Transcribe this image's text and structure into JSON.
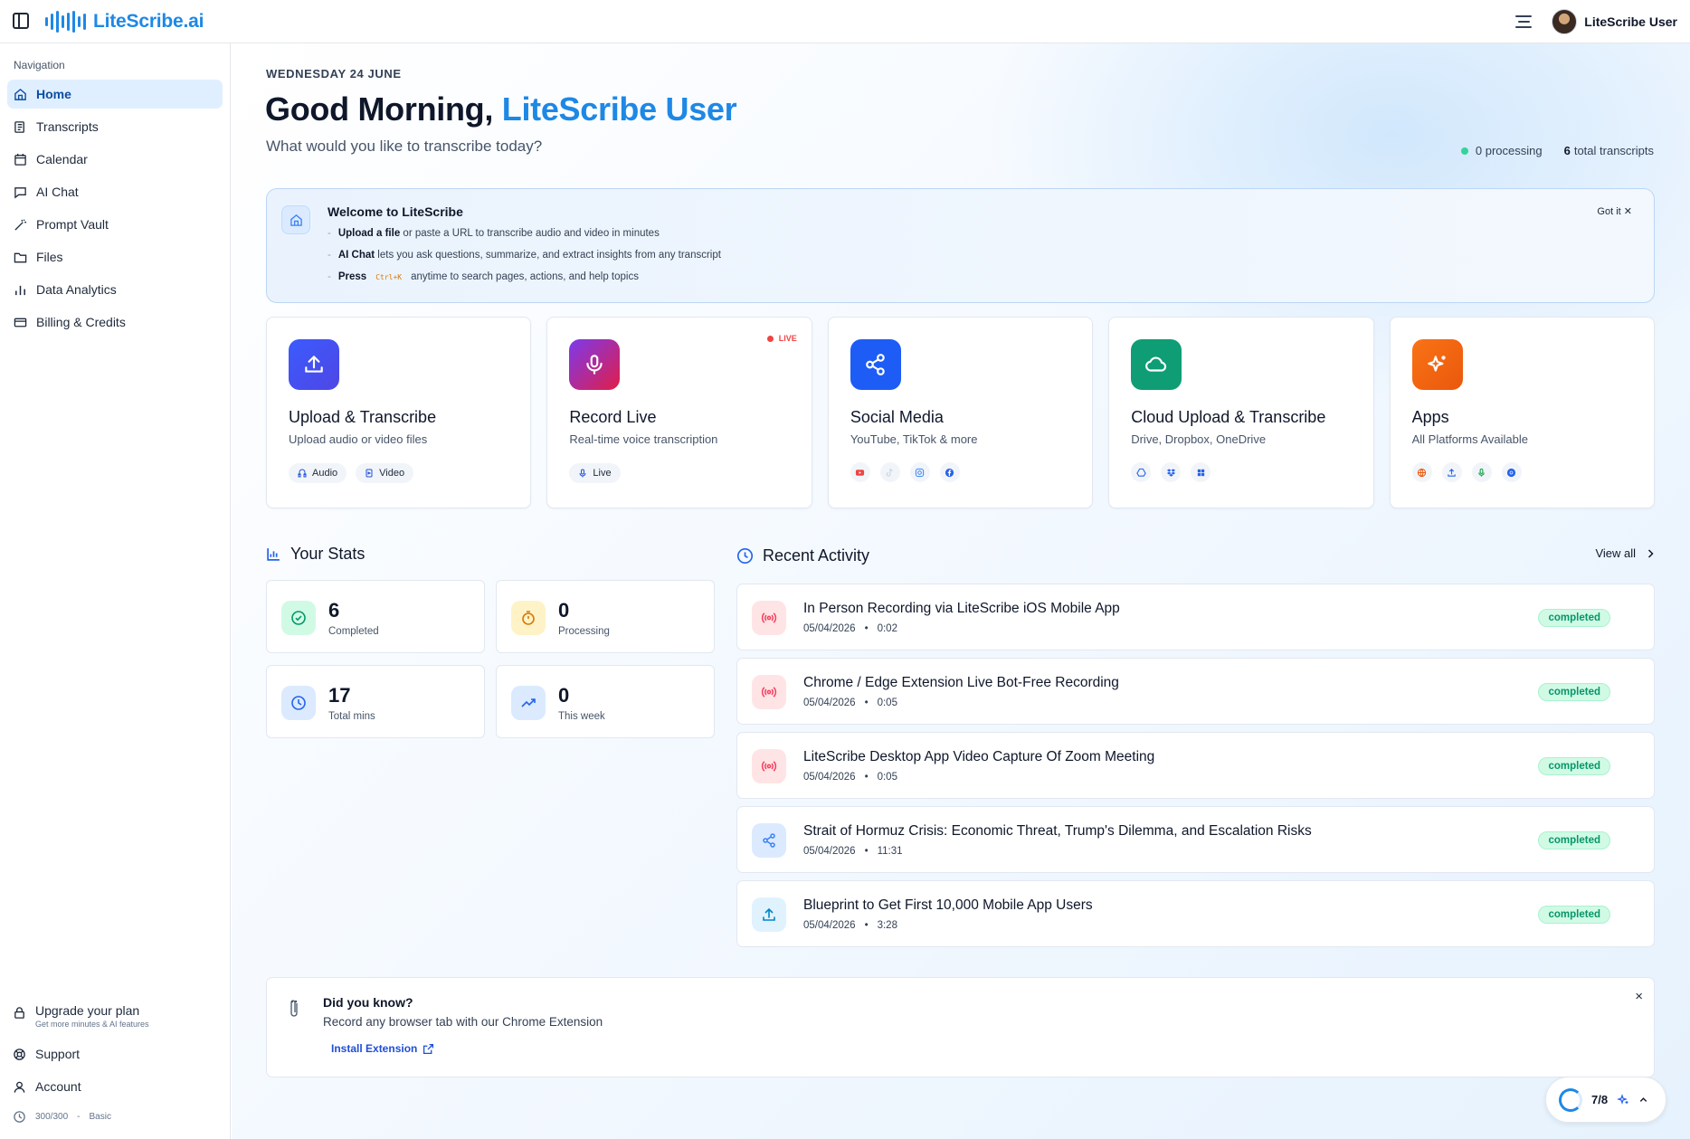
{
  "app": {
    "logo_text": "LiteScribe.ai",
    "user_name": "LiteScribe User"
  },
  "colors": {
    "brand": "#1e88e5",
    "upload": "#4f46e5",
    "record": "#e11d48",
    "social": "#1d4ed8",
    "cloud": "#0f9d75",
    "apps": "#ea580c",
    "completed": "#059669"
  },
  "sidebar": {
    "heading": "Navigation",
    "items": [
      {
        "label": "Home",
        "icon": "home-icon",
        "active": true
      },
      {
        "label": "Transcripts",
        "icon": "transcripts-icon"
      },
      {
        "label": "Calendar",
        "icon": "calendar-icon"
      },
      {
        "label": "AI Chat",
        "icon": "chat-icon"
      },
      {
        "label": "Prompt Vault",
        "icon": "wand-icon"
      },
      {
        "label": "Files",
        "icon": "folder-icon"
      },
      {
        "label": "Data Analytics",
        "icon": "bar-chart-icon"
      },
      {
        "label": "Billing & Credits",
        "icon": "credit-card-icon"
      }
    ],
    "upgrade": {
      "title": "Upgrade your plan",
      "sub": "Get more minutes & AI features"
    },
    "support": "Support",
    "account": "Account",
    "credits": "300/300",
    "credits_sep": "-",
    "plan": "Basic"
  },
  "header": {
    "date": "WEDNESDAY 24 JUNE",
    "greeting": "Good Morning,",
    "name": "LiteScribe User",
    "subtitle": "What would you like to transcribe today?",
    "processing": "0 processing",
    "total_count": "6",
    "total_label": "total transcripts"
  },
  "welcome": {
    "title": "Welcome to LiteScribe",
    "l1_bold": "Upload a file",
    "l1_rest": "or paste a URL to transcribe audio and video in minutes",
    "l2_bold": "AI Chat",
    "l2_rest": "lets you ask questions, summarize, and extract insights from any transcript",
    "l3_bold": "Press",
    "l3_key": "Ctrl+K",
    "l3_rest": "anytime to search pages, actions, and help topics",
    "dismiss": "Got it"
  },
  "actions": {
    "upload": {
      "title": "Upload & Transcribe",
      "sub": "Upload audio or video files",
      "chip1": "Audio",
      "chip2": "Video"
    },
    "record": {
      "title": "Record Live",
      "sub": "Real-time voice transcription",
      "badge": "LIVE",
      "chip1": "Live"
    },
    "social": {
      "title": "Social Media",
      "sub": "YouTube, TikTok & more",
      "platforms": [
        "youtube-icon",
        "tiktok-icon",
        "instagram-icon",
        "facebook-icon"
      ]
    },
    "cloud": {
      "title": "Cloud Upload & Transcribe",
      "sub": "Drive, Dropbox, OneDrive",
      "platforms": [
        "google-drive-icon",
        "dropbox-icon",
        "onedrive-icon"
      ]
    },
    "apps": {
      "title": "Apps",
      "sub": "All Platforms Available",
      "platforms": [
        "web-icon",
        "upload-icon",
        "mic-icon",
        "chrome-icon"
      ]
    }
  },
  "stats": {
    "title": "Your Stats",
    "items": [
      {
        "value": "6",
        "label": "Completed"
      },
      {
        "value": "0",
        "label": "Processing"
      },
      {
        "value": "17",
        "label": "Total mins"
      },
      {
        "value": "0",
        "label": "This week"
      }
    ]
  },
  "activity": {
    "title": "Recent Activity",
    "view_all": "View all",
    "items": [
      {
        "title": "In Person Recording via LiteScribe iOS Mobile App",
        "date": "05/04/2026",
        "sep": "•",
        "duration": "0:02",
        "status": "completed",
        "icon": "broadcast-icon"
      },
      {
        "title": "Chrome / Edge Extension Live Bot-Free Recording",
        "date": "05/04/2026",
        "sep": "•",
        "duration": "0:05",
        "status": "completed",
        "icon": "broadcast-icon"
      },
      {
        "title": "LiteScribe Desktop App Video Capture Of Zoom Meeting",
        "date": "05/04/2026",
        "sep": "•",
        "duration": "0:05",
        "status": "completed",
        "icon": "broadcast-icon"
      },
      {
        "title": "Strait of Hormuz Crisis: Economic Threat, Trump's Dilemma, and Escalation Risks",
        "date": "05/04/2026",
        "sep": "•",
        "duration": "11:31",
        "status": "completed",
        "icon": "share-icon"
      },
      {
        "title": "Blueprint to Get First 10,000 Mobile App Users",
        "date": "05/04/2026",
        "sep": "•",
        "duration": "3:28",
        "status": "completed",
        "icon": "upload-icon"
      }
    ]
  },
  "tip": {
    "title": "Did you know?",
    "text": "Record any browser tab with our Chrome Extension",
    "link": "Install Extension",
    "close": "×"
  },
  "progress": {
    "label": "7/8"
  }
}
